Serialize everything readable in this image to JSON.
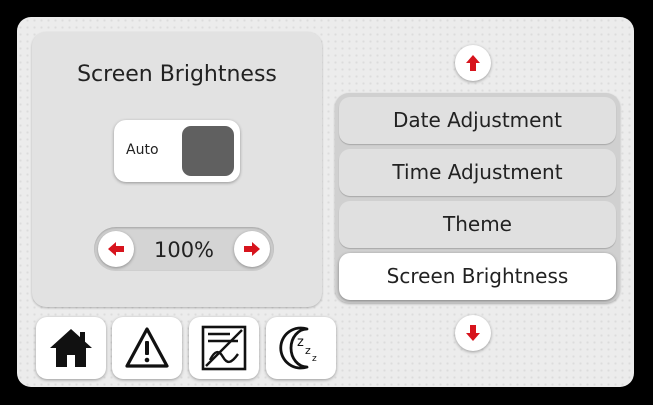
{
  "brightness_panel": {
    "title": "Screen Brightness",
    "auto_label": "Auto",
    "auto_enabled": false,
    "value_display": "100%",
    "decrease_icon": "arrow-left-icon",
    "increase_icon": "arrow-right-icon"
  },
  "settings_menu": {
    "scroll_up_icon": "arrow-up-icon",
    "scroll_down_icon": "arrow-down-icon",
    "items": [
      {
        "label": "Date Adjustment",
        "selected": false
      },
      {
        "label": "Time Adjustment",
        "selected": false
      },
      {
        "label": "Theme",
        "selected": false
      },
      {
        "label": "Screen Brightness",
        "selected": true
      }
    ]
  },
  "bottom_nav": {
    "items": [
      {
        "icon": "home-icon"
      },
      {
        "icon": "warning-icon"
      },
      {
        "icon": "curve-display-icon"
      },
      {
        "icon": "sleep-icon"
      }
    ]
  },
  "colors": {
    "arrow_red": "#d7141d",
    "toggle_knob": "#606060",
    "background": "#ececec",
    "selected_item": "#ffffff"
  }
}
